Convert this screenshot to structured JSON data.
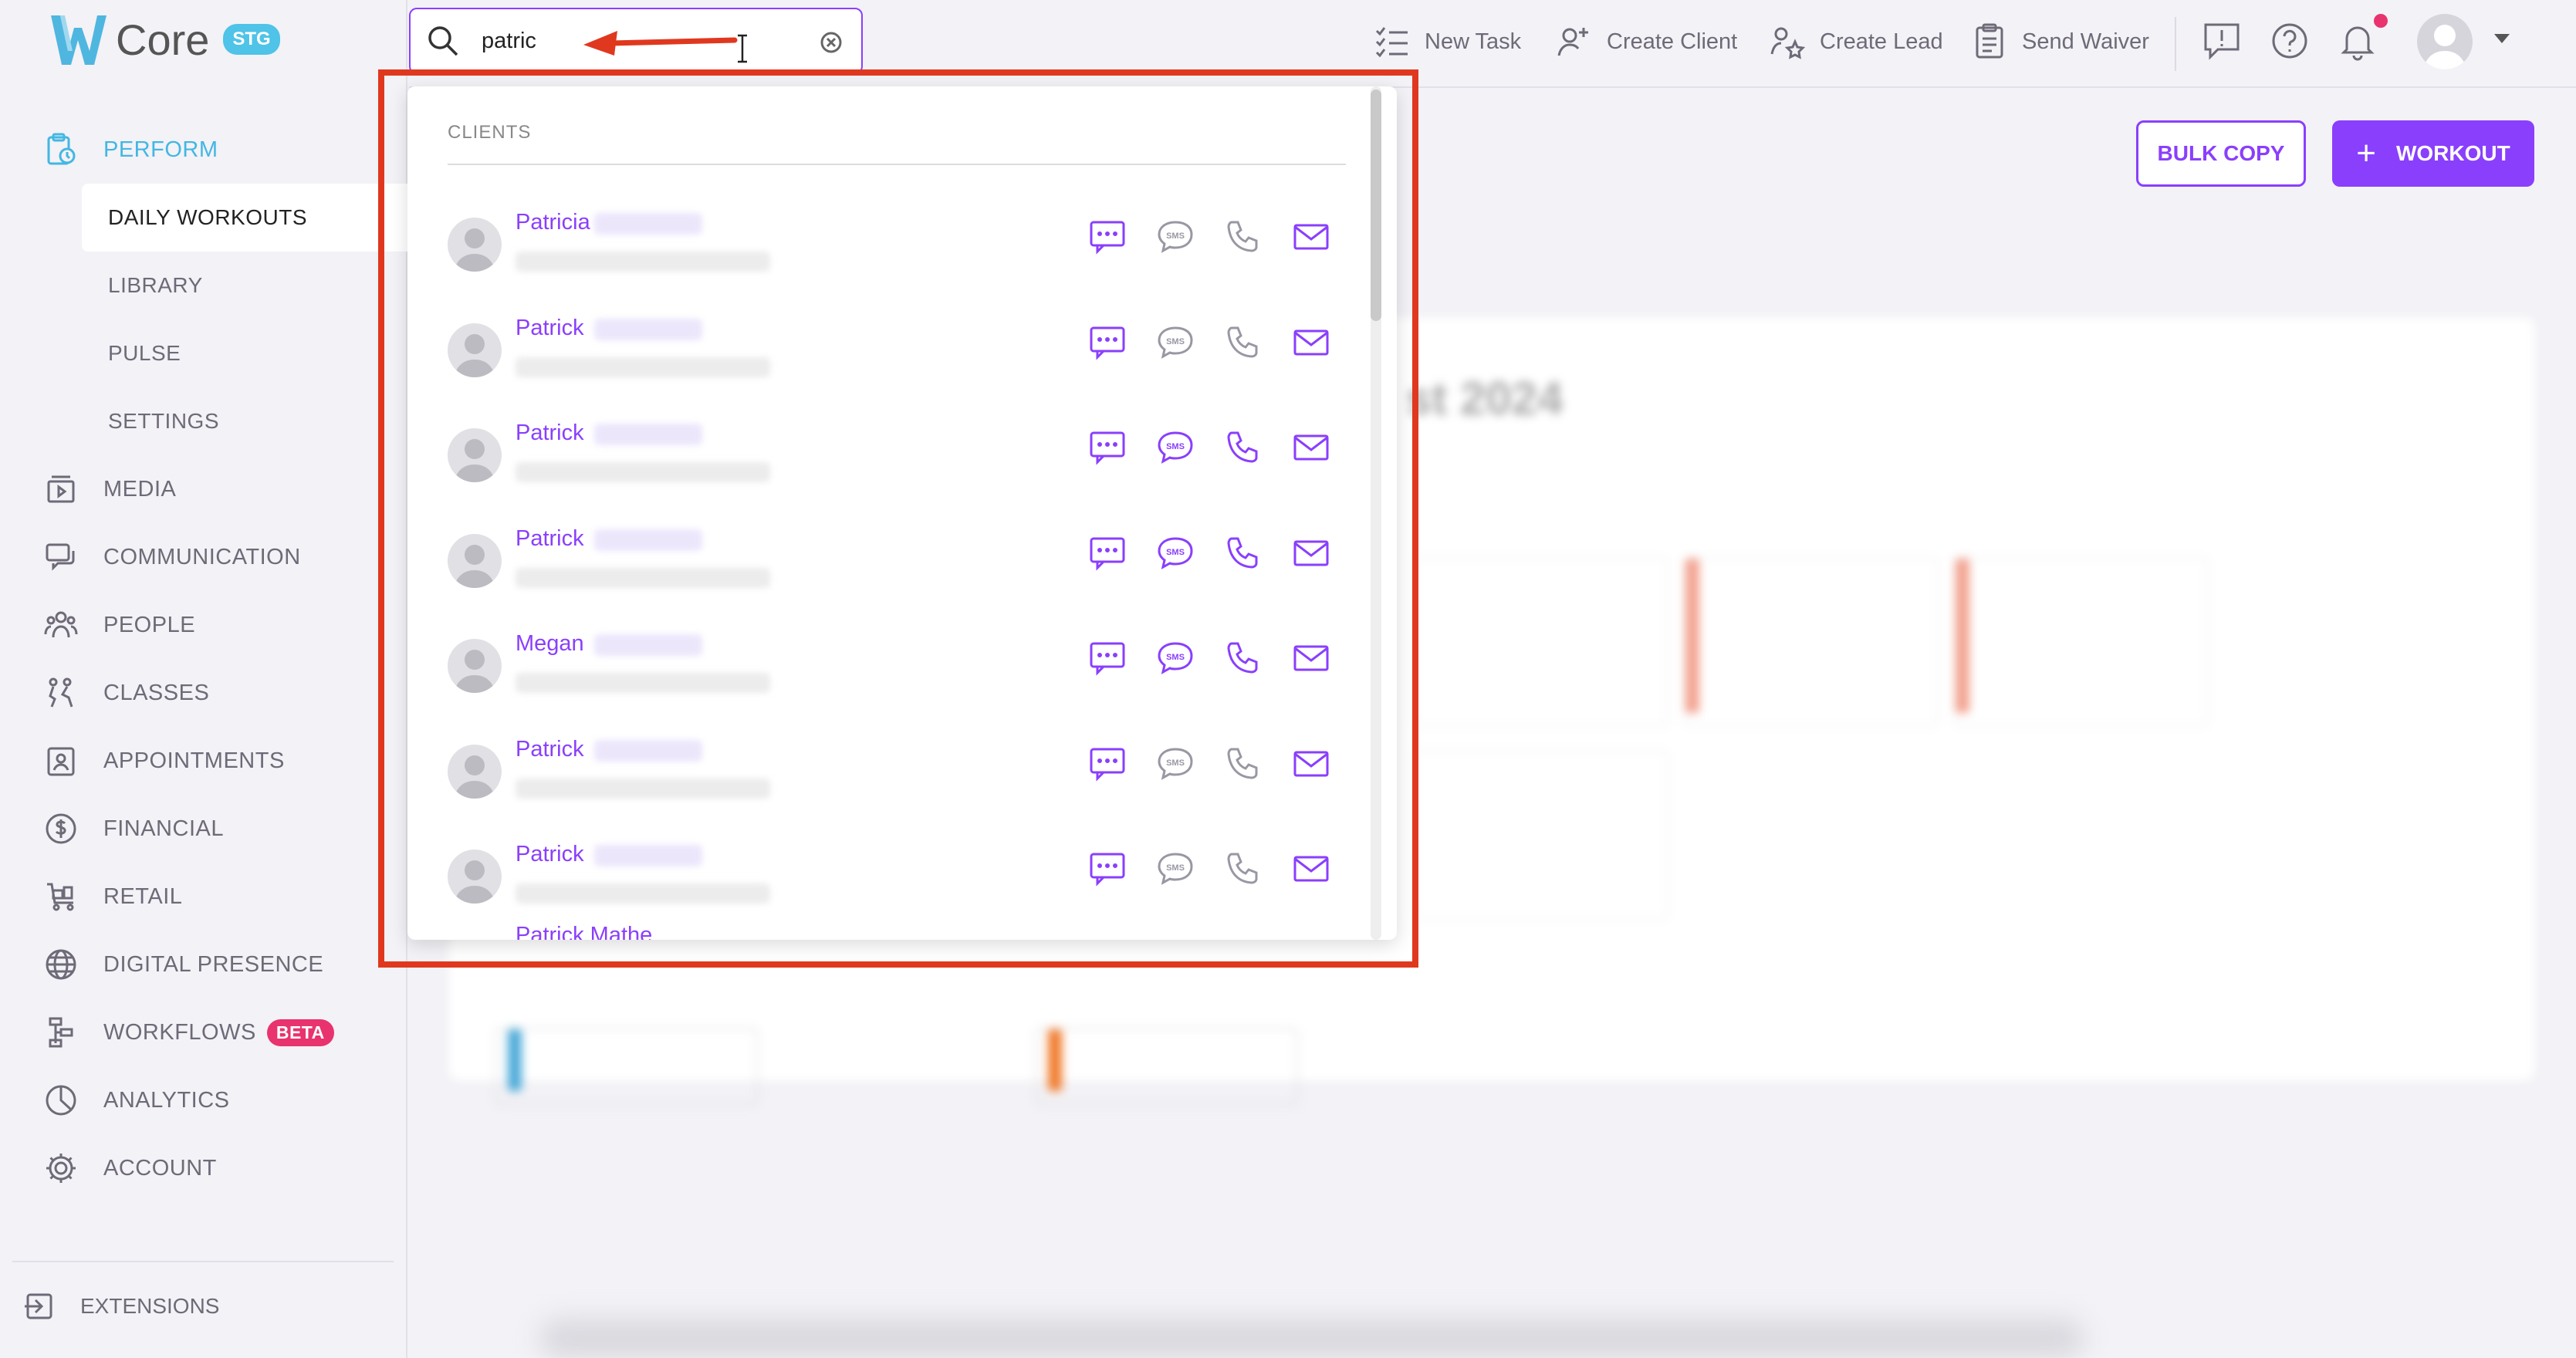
{
  "app": {
    "logo_text": "Core",
    "badge": "STG"
  },
  "search": {
    "value": "patric"
  },
  "top_actions": [
    {
      "label": "New Task",
      "icon": "task-list-icon"
    },
    {
      "label": "Create Client",
      "icon": "add-client-icon"
    },
    {
      "label": "Create Lead",
      "icon": "lead-star-icon"
    },
    {
      "label": "Send Waiver",
      "icon": "clipboard-icon"
    }
  ],
  "sidebar": {
    "items": [
      {
        "label": "PERFORM",
        "icon": "perform-icon",
        "active": true
      },
      {
        "label": "DAILY WORKOUTS",
        "sub": true,
        "selected": true
      },
      {
        "label": "LIBRARY",
        "sub": true
      },
      {
        "label": "PULSE",
        "sub": true
      },
      {
        "label": "SETTINGS",
        "sub": true
      },
      {
        "label": "MEDIA",
        "icon": "media-icon"
      },
      {
        "label": "COMMUNICATION",
        "icon": "chat-icon"
      },
      {
        "label": "PEOPLE",
        "icon": "people-icon"
      },
      {
        "label": "CLASSES",
        "icon": "classes-icon"
      },
      {
        "label": "APPOINTMENTS",
        "icon": "calendar-icon"
      },
      {
        "label": "FINANCIAL",
        "icon": "dollar-icon"
      },
      {
        "label": "RETAIL",
        "icon": "cart-icon"
      },
      {
        "label": "DIGITAL PRESENCE",
        "icon": "globe-icon"
      },
      {
        "label": "WORKFLOWS",
        "icon": "workflow-icon",
        "badge": "BETA"
      },
      {
        "label": "ANALYTICS",
        "icon": "pie-icon"
      },
      {
        "label": "ACCOUNT",
        "icon": "gear-icon"
      }
    ],
    "extensions": "EXTENSIONS"
  },
  "main": {
    "bulk_copy": "BULK COPY",
    "workout": "WORKOUT",
    "panel_title": "st 2024"
  },
  "dropdown": {
    "section": "CLIENTS",
    "clients": [
      {
        "name": "Patricia",
        "sms_active": false
      },
      {
        "name": "Patrick",
        "sms_active": false
      },
      {
        "name": "Patrick",
        "sms_active": true
      },
      {
        "name": "Patrick",
        "sms_active": true
      },
      {
        "name": "Megan",
        "sms_active": true
      },
      {
        "name": "Patrick",
        "sms_active": false
      },
      {
        "name": "Patrick",
        "sms_active": false
      }
    ],
    "partial_row": "Patrick Mathe"
  },
  "colors": {
    "accent": "#8a3ffc",
    "active_nav": "#43b7e3",
    "annotation": "#e0381f",
    "beta": "#e8336e"
  }
}
